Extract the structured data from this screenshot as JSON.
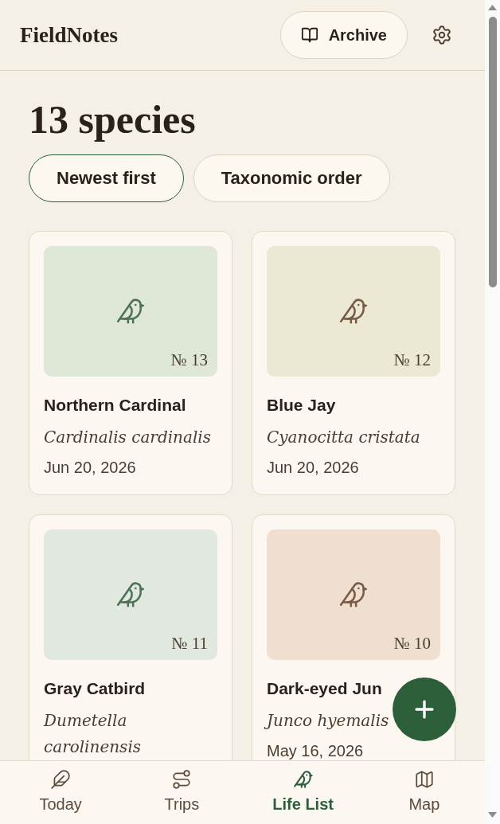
{
  "header": {
    "title": "FieldNotes",
    "archive_button": "Archive"
  },
  "heading": "13 species",
  "sort_options": [
    {
      "label": "Newest first",
      "selected": true
    },
    {
      "label": "Taxonomic order",
      "selected": false
    }
  ],
  "species": [
    {
      "number": "№ 13",
      "name": "Northern Cardinal",
      "scientific_name": "Cardinalis cardinalis",
      "date": "Jun 20, 2026",
      "color": "#dfe8d7"
    },
    {
      "number": "№ 12",
      "name": "Blue Jay",
      "scientific_name": "Cyanocitta cristata",
      "date": "Jun 20, 2026",
      "color": "#ebe8d3"
    },
    {
      "number": "№ 11",
      "name": "Gray Catbird",
      "scientific_name": "Dumetella carolinensis",
      "color": "#e0e8e0"
    },
    {
      "number": "№ 10",
      "name": "Dark-eyed Jun",
      "scientific_name": "Junco hyemalis",
      "date": "May 16, 2026",
      "color": "#efdfd1"
    }
  ],
  "nav": [
    {
      "label": "Today",
      "selected": false
    },
    {
      "label": "Trips",
      "selected": false
    },
    {
      "label": "Life List",
      "selected": true
    },
    {
      "label": "Map",
      "selected": false
    }
  ]
}
